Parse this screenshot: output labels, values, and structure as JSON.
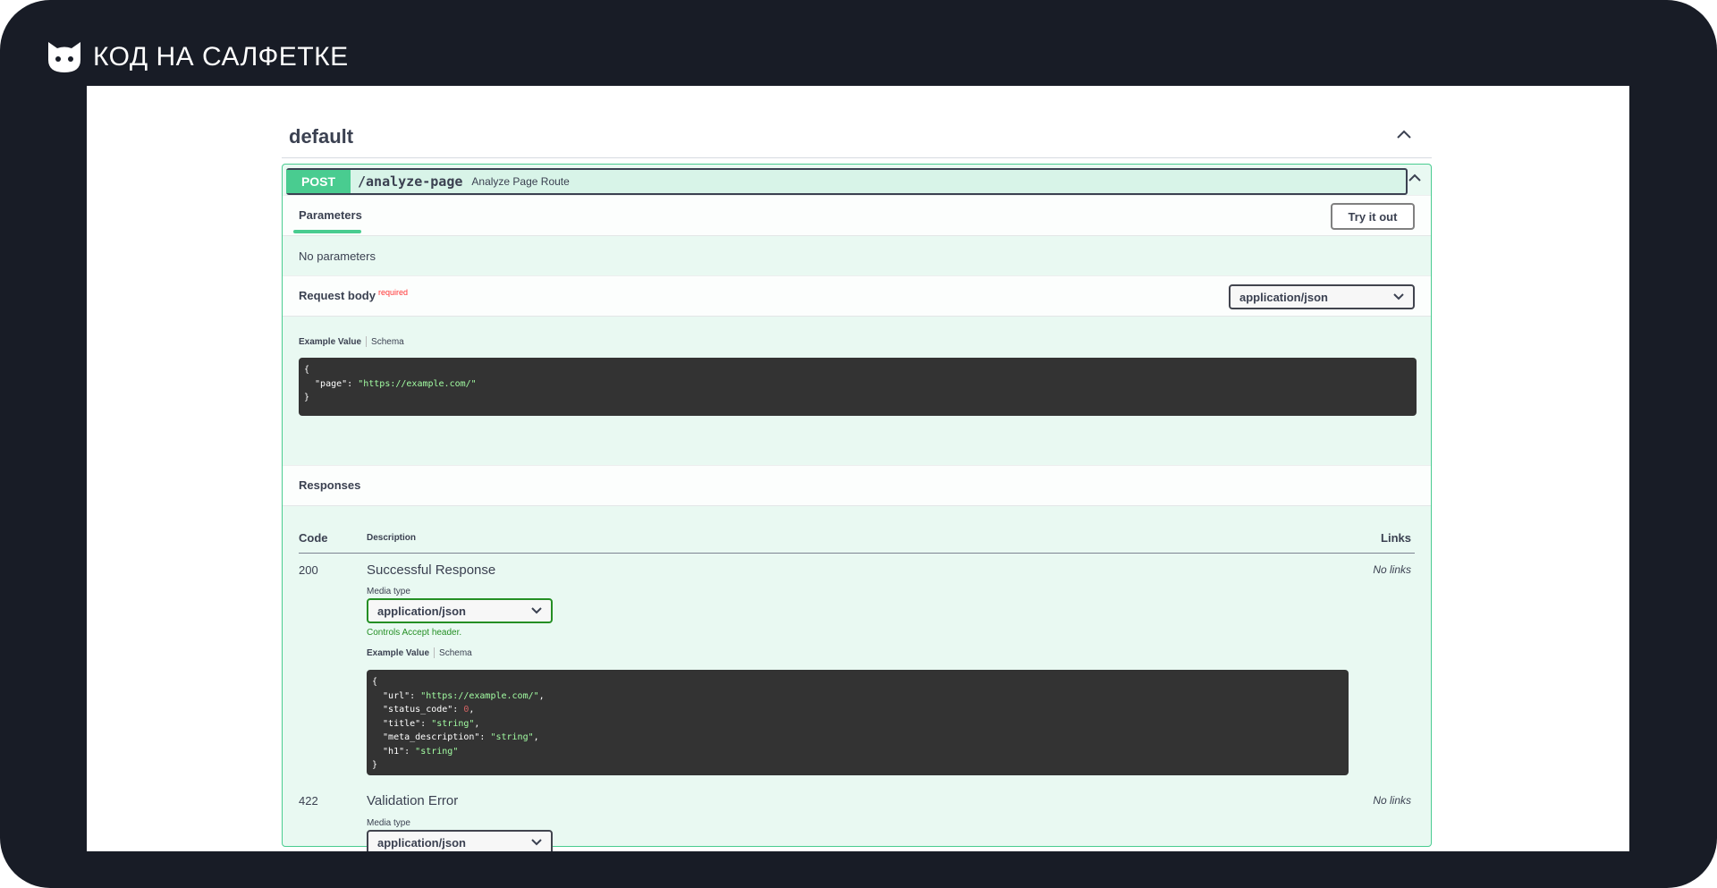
{
  "brand": {
    "logo_icon": "cat-head-icon",
    "name": "КОД НА САЛФЕТКЕ"
  },
  "tag": {
    "title": "default",
    "collapse_icon": "chevron-up-icon"
  },
  "operation": {
    "method": "POST",
    "path": "/analyze-page",
    "summary": "Analyze Page Route",
    "collapse_icon": "chevron-up-icon"
  },
  "parameters": {
    "tab_label": "Parameters",
    "try_label": "Try it out",
    "empty_text": "No parameters"
  },
  "request_body": {
    "title": "Request body",
    "required_label": "required",
    "content_type": "application/json",
    "example_tab": "Example Value",
    "schema_tab": "Schema",
    "example_lines": [
      [
        {
          "t": "{",
          "c": "p"
        }
      ],
      [
        {
          "t": "  \"page\": ",
          "c": "p"
        },
        {
          "t": "\"https://example.com/\"",
          "c": "s"
        }
      ],
      [
        {
          "t": "}",
          "c": "p"
        }
      ]
    ]
  },
  "responses": {
    "title": "Responses",
    "col_code": "Code",
    "col_description": "Description",
    "col_links": "Links",
    "items": [
      {
        "code": "200",
        "description": "Successful Response",
        "links": "No links",
        "media_type_label": "Media type",
        "media_type": "application/json",
        "accept_note": "Controls Accept header.",
        "example_tab": "Example Value",
        "schema_tab": "Schema",
        "example_lines": [
          [
            {
              "t": "{",
              "c": "p"
            }
          ],
          [
            {
              "t": "  \"url\": ",
              "c": "p"
            },
            {
              "t": "\"https://example.com/\"",
              "c": "s"
            },
            {
              "t": ",",
              "c": "p"
            }
          ],
          [
            {
              "t": "  \"status_code\": ",
              "c": "p"
            },
            {
              "t": "0",
              "c": "n"
            },
            {
              "t": ",",
              "c": "p"
            }
          ],
          [
            {
              "t": "  \"title\": ",
              "c": "p"
            },
            {
              "t": "\"string\"",
              "c": "s"
            },
            {
              "t": ",",
              "c": "p"
            }
          ],
          [
            {
              "t": "  \"meta_description\": ",
              "c": "p"
            },
            {
              "t": "\"string\"",
              "c": "s"
            },
            {
              "t": ",",
              "c": "p"
            }
          ],
          [
            {
              "t": "  \"h1\": ",
              "c": "p"
            },
            {
              "t": "\"string\"",
              "c": "s"
            }
          ],
          [
            {
              "t": "}",
              "c": "p"
            }
          ]
        ]
      },
      {
        "code": "422",
        "description": "Validation Error",
        "links": "No links",
        "media_type_label": "Media type",
        "media_type": "application/json"
      }
    ]
  },
  "colors": {
    "frame": "#181c26",
    "post_green": "#49cc90",
    "code_bg": "#333333",
    "string_green": "#a2fca2",
    "number_red": "#d36363",
    "accept_green": "#248f24",
    "required_red": "#ff3333"
  }
}
